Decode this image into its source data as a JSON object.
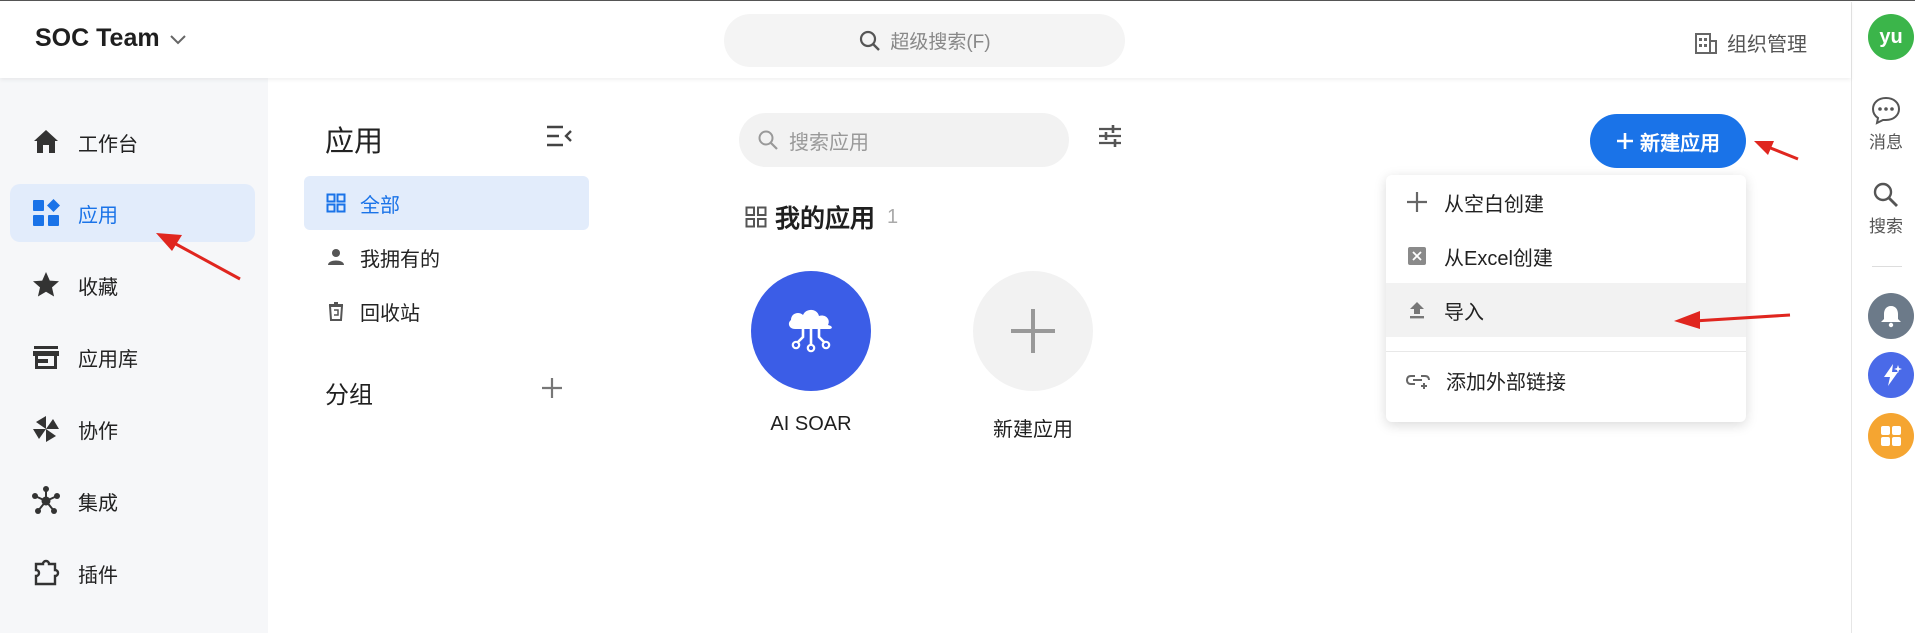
{
  "header": {
    "team_name": "SOC Team",
    "super_search_placeholder": "超级搜索(F)",
    "org_manage_label": "组织管理"
  },
  "rail": {
    "avatar_text": "yu",
    "messages_label": "消息",
    "search_label": "搜索"
  },
  "sidebar": {
    "items": [
      {
        "label": "工作台",
        "icon": "home-icon"
      },
      {
        "label": "应用",
        "icon": "apps-icon",
        "active": true
      },
      {
        "label": "收藏",
        "icon": "star-icon"
      },
      {
        "label": "应用库",
        "icon": "store-icon"
      },
      {
        "label": "协作",
        "icon": "collaboration-icon"
      },
      {
        "label": "集成",
        "icon": "integration-icon"
      },
      {
        "label": "插件",
        "icon": "plugin-icon"
      }
    ]
  },
  "apps_panel": {
    "title": "应用",
    "items": [
      {
        "label": "全部",
        "active": true
      },
      {
        "label": "我拥有的"
      },
      {
        "label": "回收站"
      }
    ],
    "group_title": "分组"
  },
  "main": {
    "search_placeholder": "搜索应用",
    "section_title": "我的应用",
    "section_count": "1",
    "apps": [
      {
        "label": "AI SOAR",
        "color": "#3b5de7"
      },
      {
        "label": "新建应用"
      }
    ],
    "new_button_label": "新建应用"
  },
  "dropdown": {
    "items": [
      {
        "label": "从空白创建",
        "icon": "plus-icon"
      },
      {
        "label": "从Excel创建",
        "icon": "excel-icon"
      },
      {
        "label": "导入",
        "icon": "upload-icon"
      },
      {
        "label": "添加外部链接",
        "icon": "link-icon"
      }
    ]
  },
  "colors": {
    "accent": "#1a73e8",
    "active_bg": "#e2ecfb",
    "annotation_arrow": "#e0261f",
    "avatar": "#3bb54a"
  }
}
